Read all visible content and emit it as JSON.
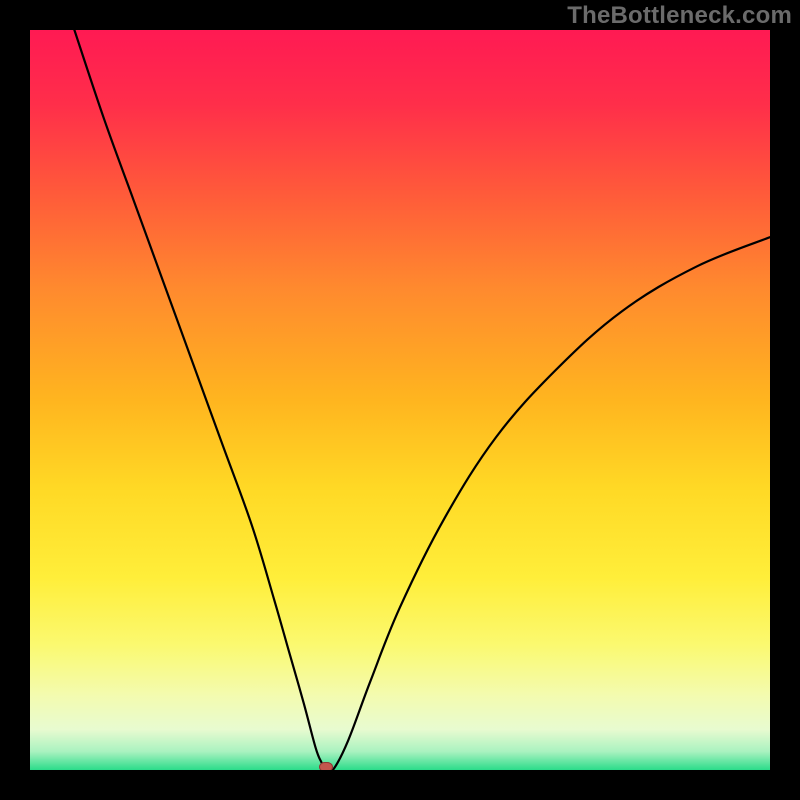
{
  "watermark": "TheBottleneck.com",
  "colors": {
    "frame_bg": "#000000",
    "gradient_stops": [
      {
        "offset": 0.0,
        "color": "#ff1a53"
      },
      {
        "offset": 0.1,
        "color": "#ff2e4a"
      },
      {
        "offset": 0.22,
        "color": "#ff5a3a"
      },
      {
        "offset": 0.35,
        "color": "#ff8a2e"
      },
      {
        "offset": 0.5,
        "color": "#ffb51f"
      },
      {
        "offset": 0.62,
        "color": "#ffd925"
      },
      {
        "offset": 0.74,
        "color": "#ffee3a"
      },
      {
        "offset": 0.83,
        "color": "#fbf96f"
      },
      {
        "offset": 0.9,
        "color": "#f3fbb0"
      },
      {
        "offset": 0.945,
        "color": "#e8fbd0"
      },
      {
        "offset": 0.975,
        "color": "#aaf2c0"
      },
      {
        "offset": 1.0,
        "color": "#2bdc8a"
      }
    ],
    "curve": "#000000",
    "marker_fill": "#c4564e",
    "marker_stroke": "#8a3a35"
  },
  "chart_data": {
    "type": "line",
    "title": "",
    "xlabel": "",
    "ylabel": "",
    "xlim": [
      0,
      100
    ],
    "ylim": [
      0,
      100
    ],
    "grid": false,
    "legend_position": "none",
    "annotations": [
      "TheBottleneck.com"
    ],
    "marker": {
      "x": 40,
      "y": 0
    },
    "series": [
      {
        "name": "curve",
        "x": [
          6,
          10,
          14,
          18,
          22,
          26,
          30,
          33,
          35,
          37,
          38.6,
          39.4,
          40,
          41,
          43,
          46,
          50,
          56,
          63,
          71,
          80,
          90,
          100
        ],
        "y": [
          100,
          88,
          77,
          66,
          55,
          44,
          33,
          23,
          16,
          9,
          3,
          1,
          0,
          0.1,
          4,
          12,
          22,
          34,
          45,
          54,
          62,
          68,
          72
        ]
      }
    ]
  }
}
